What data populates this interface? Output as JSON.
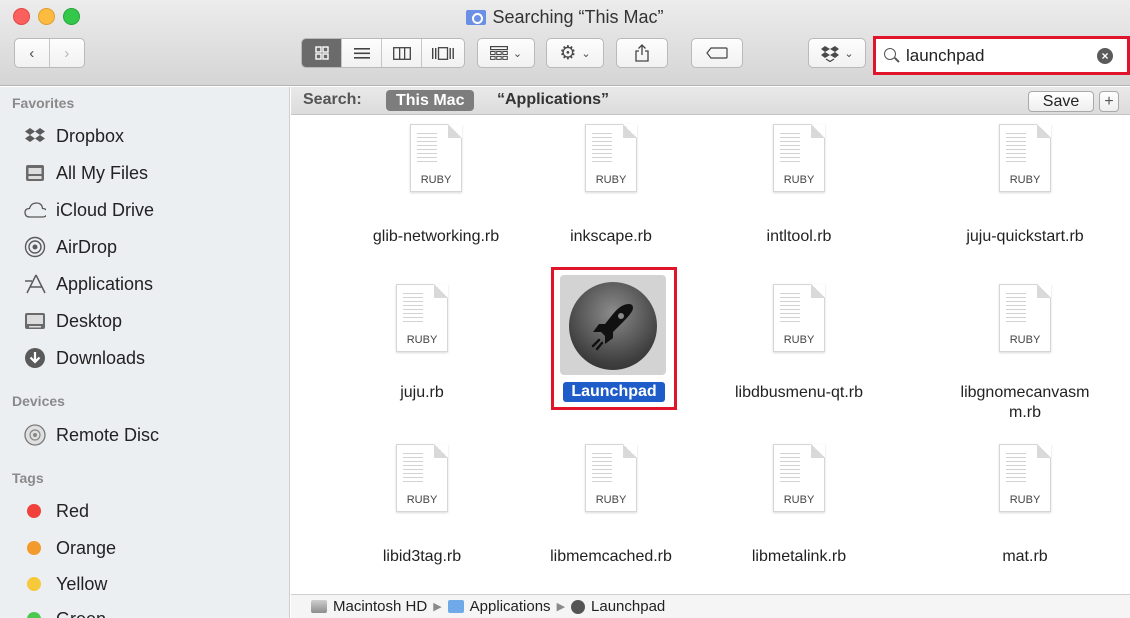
{
  "window": {
    "title": "Searching “This Mac”"
  },
  "toolbar": {
    "back_icon": "chevron-left-icon",
    "forward_icon": "chevron-right-icon",
    "view_modes": [
      "icon-view",
      "list-view",
      "column-view",
      "cover-flow-view"
    ],
    "active_view": "icon-view",
    "search_value": "launchpad"
  },
  "sidebar": {
    "favorites_header": "Favorites",
    "favorites": [
      {
        "label": "Dropbox",
        "icon": "dropbox-icon"
      },
      {
        "label": "All My Files",
        "icon": "all-files-icon"
      },
      {
        "label": "iCloud Drive",
        "icon": "cloud-icon"
      },
      {
        "label": "AirDrop",
        "icon": "airdrop-icon"
      },
      {
        "label": "Applications",
        "icon": "applications-icon"
      },
      {
        "label": "Desktop",
        "icon": "desktop-icon"
      },
      {
        "label": "Downloads",
        "icon": "downloads-icon"
      }
    ],
    "devices_header": "Devices",
    "devices": [
      {
        "label": "Remote Disc",
        "icon": "disc-icon"
      }
    ],
    "tags_header": "Tags",
    "tags": [
      {
        "label": "Red",
        "color": "#f0413b"
      },
      {
        "label": "Orange",
        "color": "#f39a2c"
      },
      {
        "label": "Yellow",
        "color": "#f5c93a"
      },
      {
        "label": "Green",
        "color": "#4cc74f"
      }
    ]
  },
  "searchbar": {
    "label": "Search:",
    "scope_active": "This Mac",
    "scope_other": "“Applications”",
    "save_label": "Save",
    "add_label": "+"
  },
  "files": [
    {
      "name": "glib-networking.rb",
      "type": "RUBY"
    },
    {
      "name": "inkscape.rb",
      "type": "RUBY"
    },
    {
      "name": "intltool.rb",
      "type": "RUBY"
    },
    {
      "name": "juju-quickstart.rb",
      "type": "RUBY"
    },
    {
      "name": "juju.rb",
      "type": "RUBY"
    },
    {
      "name": "Launchpad",
      "type": "app"
    },
    {
      "name": "libdbusmenu-qt.rb",
      "type": "RUBY"
    },
    {
      "name": "libgnomecanvasm m.rb",
      "name_line1": "libgnomecanvasm",
      "name_line2": "m.rb",
      "type": "RUBY"
    },
    {
      "name": "libid3tag.rb",
      "type": "RUBY"
    },
    {
      "name": "libmemcached.rb",
      "type": "RUBY"
    },
    {
      "name": "libmetalink.rb",
      "type": "RUBY"
    },
    {
      "name": "mat.rb",
      "type": "RUBY"
    }
  ],
  "pathbar": {
    "items": [
      "Macintosh HD",
      "Applications",
      "Launchpad"
    ],
    "separator": "▶"
  },
  "colors": {
    "highlight_red": "#e0142a",
    "selection_blue": "#1d5cc9"
  }
}
